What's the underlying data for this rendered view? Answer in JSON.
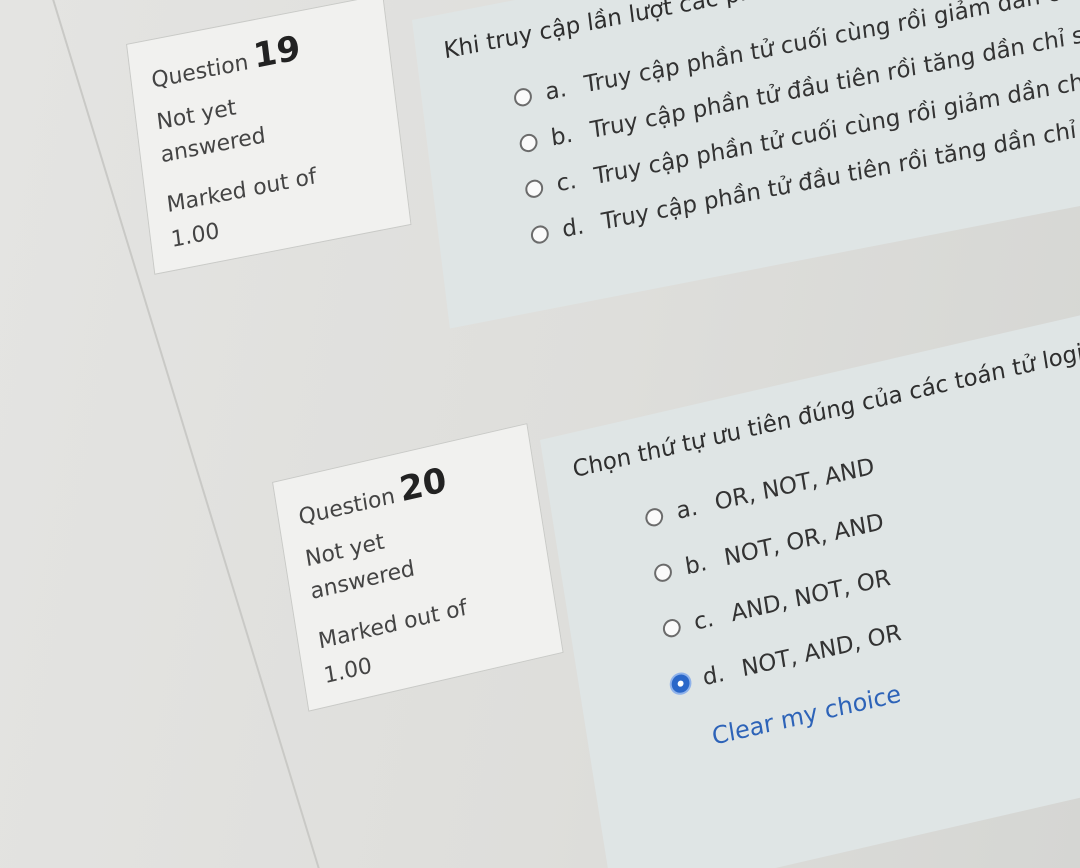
{
  "questions": [
    {
      "label": "Question",
      "number": "19",
      "state_line1": "Not yet",
      "state_line2": "answered",
      "grade_line1": "Marked out of",
      "grade_line2": "1.00",
      "text": "Khi truy cập lần lượt các phần tử của mảng hai chiều",
      "answers": [
        {
          "letter": "a.",
          "text": "Truy cập phần tử cuối cùng rồi giảm dần chỉ số hàng",
          "checked": false
        },
        {
          "letter": "b.",
          "text": "Truy cập phần tử đầu tiên rồi tăng dần chỉ số cột, k",
          "checked": false
        },
        {
          "letter": "c.",
          "text": "Truy cập phần tử cuối cùng rồi giảm dần chỉ số cộ",
          "checked": false
        },
        {
          "letter": "d.",
          "text": "Truy cập phần tử đầu tiên rồi tăng dần chỉ số hà",
          "checked": false
        }
      ]
    },
    {
      "label": "Question",
      "number": "20",
      "state_line1": "Not yet",
      "state_line2": "answered",
      "grade_line1": "Marked out of",
      "grade_line2": "1.00",
      "text": "Chọn thứ tự ưu tiên đúng của các toán tử logic trong",
      "answers": [
        {
          "letter": "a.",
          "text": "OR, NOT, AND",
          "checked": false
        },
        {
          "letter": "b.",
          "text": "NOT, OR, AND",
          "checked": false
        },
        {
          "letter": "c.",
          "text": "AND, NOT, OR",
          "checked": false
        },
        {
          "letter": "d.",
          "text": "NOT, AND, OR",
          "checked": true
        }
      ],
      "clear_label": "Clear my choice"
    }
  ],
  "colors": {
    "content_bg": "#dfe5e5",
    "info_bg": "#f1f1ef",
    "link": "#2d63b8",
    "radio_checked": "#2a67c9"
  }
}
